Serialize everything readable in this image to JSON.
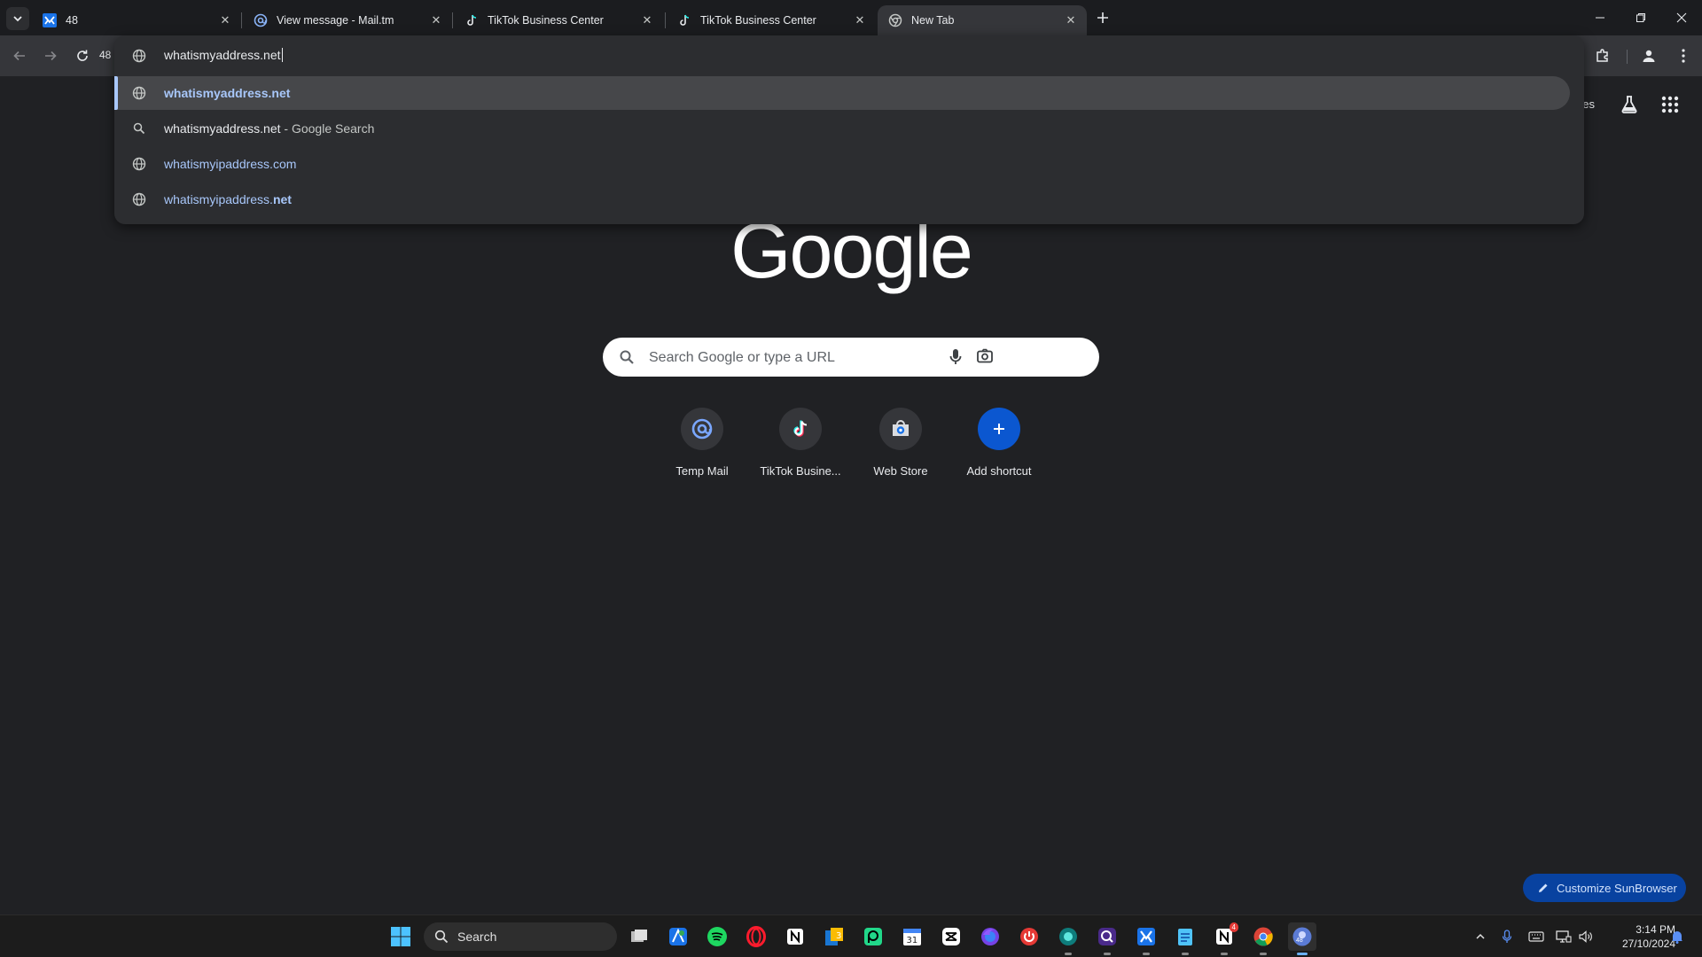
{
  "tabs": [
    {
      "title": "48",
      "icon": "mail-m-icon"
    },
    {
      "title": "View message - Mail.tm",
      "icon": "at-icon"
    },
    {
      "title": "TikTok Business Center",
      "icon": "tiktok-icon"
    },
    {
      "title": "TikTok Business Center",
      "icon": "tiktok-icon"
    },
    {
      "title": "New Tab",
      "icon": "chrome-icon"
    }
  ],
  "toolbar": {
    "zoom_badge": "48",
    "omnibox_value": "whatismyaddress.net"
  },
  "suggestions": [
    {
      "main": "whatismyaddress.net",
      "suffix": "",
      "type": "url",
      "selected": true
    },
    {
      "main": "whatismyaddress.net",
      "suffix": " - Google Search",
      "type": "search",
      "selected": false
    },
    {
      "main": "whatismyipaddress.com",
      "suffix": "",
      "type": "url",
      "selected": false
    },
    {
      "main": "whatismyipaddress.",
      "suffix": "net",
      "type": "url",
      "selected": false
    }
  ],
  "ntp": {
    "header_partial_text": "ges",
    "logo_text": "Google",
    "search_placeholder": "Search Google or type a URL",
    "shortcuts": [
      {
        "label": "Temp Mail",
        "icon": "at-icon"
      },
      {
        "label": "TikTok Busine...",
        "icon": "tiktok-icon"
      },
      {
        "label": "Web Store",
        "icon": "web-store-icon"
      },
      {
        "label": "Add shortcut",
        "icon": "plus-icon"
      }
    ],
    "customize_label": "Customize SunBrowser"
  },
  "taskbar": {
    "search_label": "Search",
    "time": "3:14 PM",
    "date": "27/10/2024",
    "badge_count": "4",
    "active_badge": "48"
  },
  "colors": {
    "background": "#202124",
    "accent": "#a8c7fa",
    "customize_bg": "#0842a0"
  }
}
